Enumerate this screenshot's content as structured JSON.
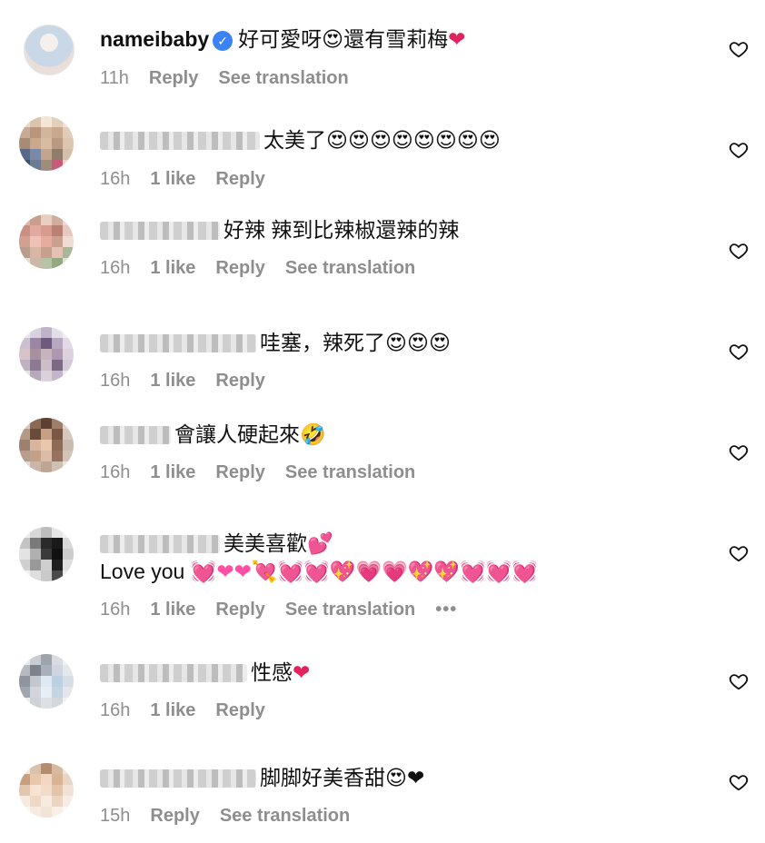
{
  "actions": {
    "reply": "Reply",
    "see_translation": "See translation",
    "more": "•••"
  },
  "comments": [
    {
      "username": "nameibaby",
      "verified": true,
      "text": "好可愛呀",
      "emojis_mid": "😍",
      "text2": "還有雪莉梅",
      "emojis_end": "❤",
      "time": "11h",
      "likes": "",
      "translate": true
    },
    {
      "username": "",
      "text": "太美了",
      "emojis_end": "😍😍😍😍😍😍😍😍",
      "time": "16h",
      "likes": "1 like",
      "translate": false
    },
    {
      "username": "",
      "text": "好辣 辣到比辣椒還辣的辣",
      "emojis_end": "",
      "time": "16h",
      "likes": "1 like",
      "translate": true
    },
    {
      "username": "",
      "text": "哇塞，辣死了",
      "emojis_end": "😍😍😍",
      "time": "16h",
      "likes": "1 like",
      "translate": false
    },
    {
      "username": "",
      "text": "會讓人硬起來",
      "emojis_end": "🤣",
      "time": "16h",
      "likes": "1 like",
      "translate": true
    },
    {
      "username": "",
      "text": "美美喜歡",
      "emojis_end": "💕",
      "line2_text": "Love you",
      "line2_emojis": "💓❤❤💘💓💓💖💗💗💖💖💓💓💓",
      "time": "16h",
      "likes": "1 like",
      "translate": true,
      "more": true
    },
    {
      "username": "",
      "text": "性感",
      "emojis_end": "❤",
      "time": "16h",
      "likes": "1 like",
      "translate": false
    },
    {
      "username": "",
      "text": "脚脚好美香甜",
      "emojis_end": "😍❤",
      "time": "15h",
      "likes": "",
      "translate": true
    }
  ]
}
